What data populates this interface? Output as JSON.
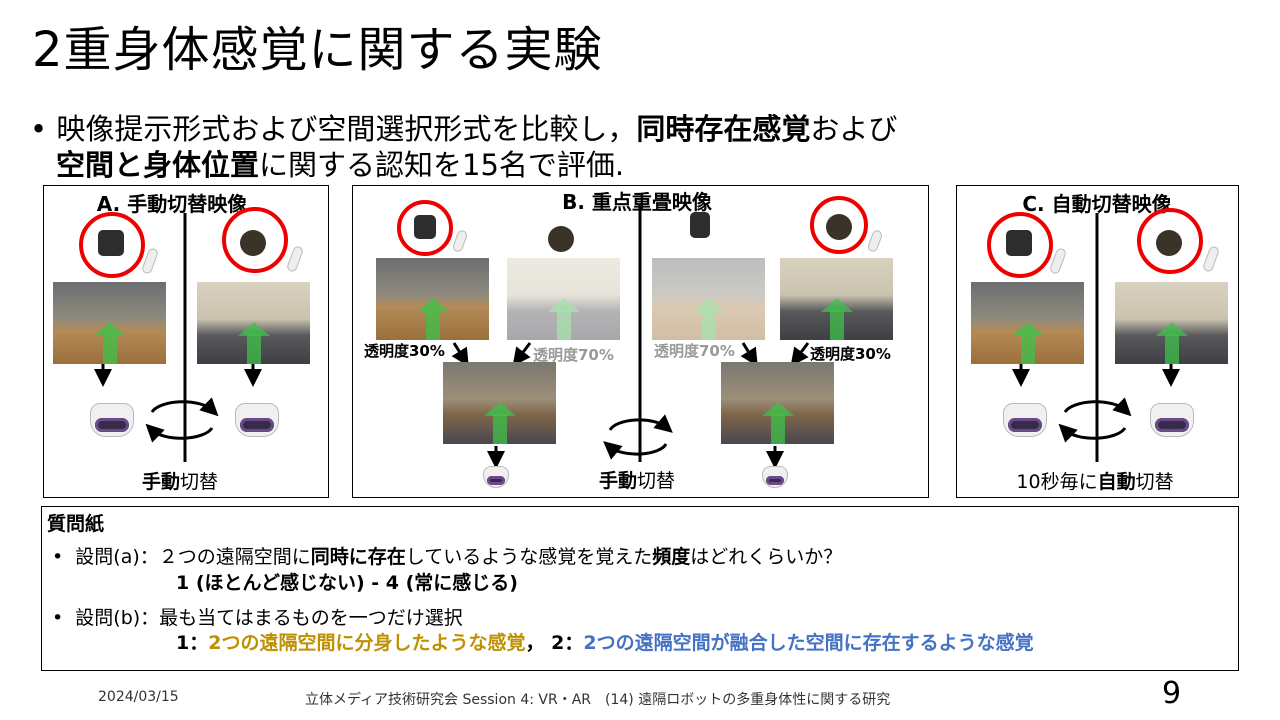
{
  "title": "2重身体感覚に関する実験",
  "bullet": {
    "line1_a": "映像提示形式および空間選択形式を比較し，",
    "line1_b": "同時存在感覚",
    "line1_c": "および",
    "line2_a": "空間と身体位置",
    "line2_b": "に関する認知を15名で評価."
  },
  "panels": {
    "a": {
      "title": "A. 手動切替映像",
      "caption_bold": "手動",
      "caption_rest": "切替"
    },
    "b": {
      "title": "B. 重点重畳映像",
      "labels": [
        "透明度30%",
        "透明度70%",
        "透明度70%",
        "透明度30%"
      ],
      "caption_bold": "手動",
      "caption_rest": "切替"
    },
    "c": {
      "title": "C. 自動切替映像",
      "caption_pre": "10秒毎に",
      "caption_bold": "自動",
      "caption_rest": "切替"
    }
  },
  "questionnaire": {
    "heading": "質問紙",
    "qa": {
      "label": "設問(a)：２つの遠隔空間に",
      "bold1": "同時に存在",
      "mid": "しているような感覚を覚えた",
      "bold2": "頻度",
      "end": "はどれくらいか？",
      "scale": "1 (ほとんど感じない) - 4 (常に感じる)"
    },
    "qb": {
      "label": "設問(b)：最も当てはまるものを一つだけ選択",
      "opt1_num": "1：",
      "opt1": "2つの遠隔空間に分身したような感覚",
      "sep": "，",
      "opt2_num": "2：",
      "opt2": "2つの遠隔空間が融合した空間に存在するような感覚"
    }
  },
  "footer": {
    "date": "2024/03/15",
    "center": "立体メディア技術研究会 Session 4: VR・AR　(14) 遠隔ロボットの多重身体性に関する研究",
    "page": "9"
  },
  "colors": {
    "gold": "#bf9000",
    "blue": "#4472c4",
    "red": "#e00000"
  }
}
